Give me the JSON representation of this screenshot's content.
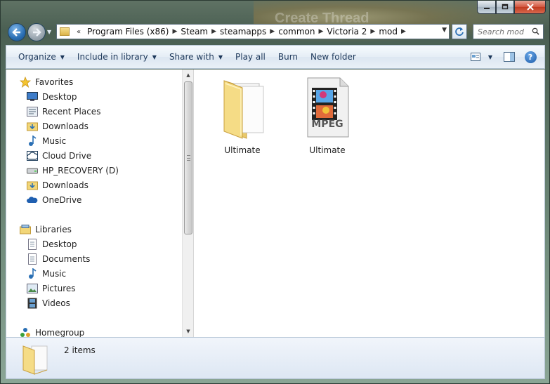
{
  "window": {
    "background_title": "Create Thread",
    "caption_buttons": [
      "minimize",
      "maximize",
      "close"
    ]
  },
  "address_bar": {
    "overflow_chevron": "«",
    "breadcrumbs": [
      "Program Files (x86)",
      "Steam",
      "steamapps",
      "common",
      "Victoria 2",
      "mod"
    ]
  },
  "search": {
    "placeholder": "Search mod"
  },
  "toolbar": {
    "organize": "Organize",
    "include_in_library": "Include in library",
    "share_with": "Share with",
    "play_all": "Play all",
    "burn": "Burn",
    "new_folder": "New folder",
    "help": "?"
  },
  "nav": {
    "favorites": {
      "label": "Favorites",
      "items": [
        "Desktop",
        "Recent Places",
        "Downloads",
        "Music",
        "Cloud Drive",
        "HP_RECOVERY (D)",
        "Downloads",
        "OneDrive"
      ]
    },
    "libraries": {
      "label": "Libraries",
      "items": [
        "Desktop",
        "Documents",
        "Music",
        "Pictures",
        "Videos"
      ]
    },
    "homegroup": {
      "label": "Homegroup"
    }
  },
  "files": [
    {
      "name": "Ultimate",
      "type": "folder",
      "icon": "folder-icon"
    },
    {
      "name": "Ultimate",
      "type": "video",
      "icon": "mpeg-file-icon",
      "badge": "MPEG"
    }
  ],
  "status_bar": {
    "item_count": "2 items"
  },
  "colors": {
    "toolbar_text": "#1e395b",
    "accent_blue": "#2a6fb4",
    "folder_yellow": "#f2d678"
  }
}
